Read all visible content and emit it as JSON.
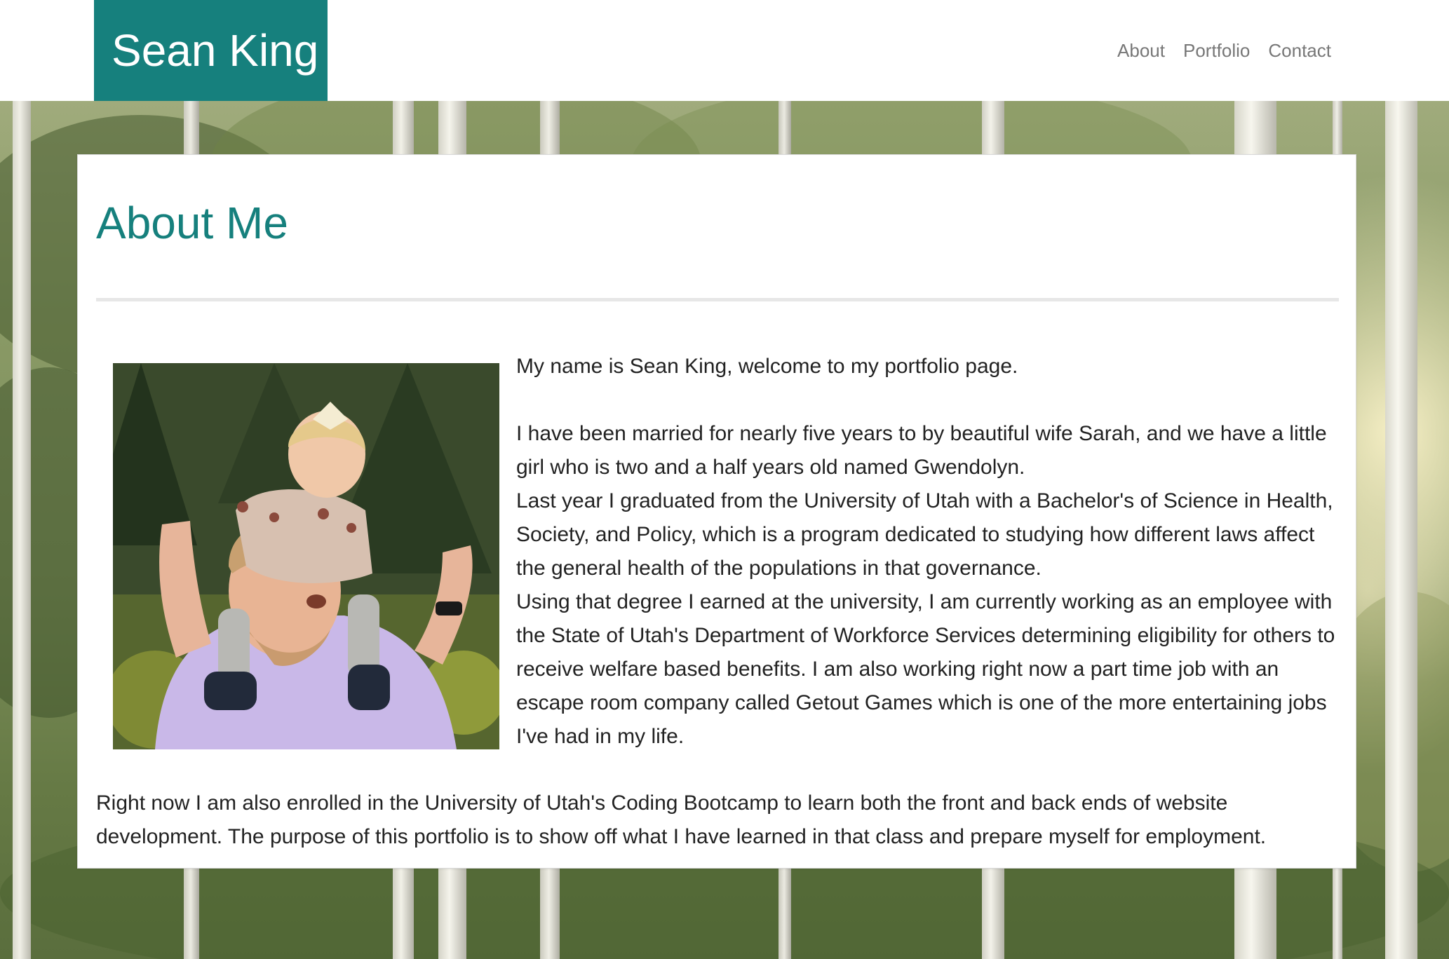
{
  "site": {
    "brand": "Sean King"
  },
  "nav": {
    "items": [
      "About",
      "Portfolio",
      "Contact"
    ]
  },
  "about": {
    "title": "About Me",
    "intro": "My name is Sean King, welcome to my portfolio page.",
    "family": "I have been married for nearly five years to by beautiful wife Sarah, and we have a little girl who is two and a half years old named Gwendolyn.",
    "education": "Last year I graduated from the University of Utah with a Bachelor's of Science in Health, Society, and Policy, which is a program dedicated to studying how different laws affect the general health of the populations in that governance.",
    "work": "Using that degree I earned at the university, I am currently working as an employee with the State of Utah's Department of Workforce Services determining eligibility for others to receive welfare based benefits. I am also working right now a part time job with an escape room company called Getout Games which is one of the more entertaining jobs I've had in my life.",
    "bootcamp": "Right now I am also enrolled in the University of Utah's Coding Bootcamp to learn both the front and back ends of website development. The purpose of this portfolio is to show off what I have learned in that class and prepare myself for employment."
  },
  "colors": {
    "accent": "#16807d",
    "nav_text": "#777777",
    "body_text": "#222222",
    "divider": "#e7e7e7"
  }
}
